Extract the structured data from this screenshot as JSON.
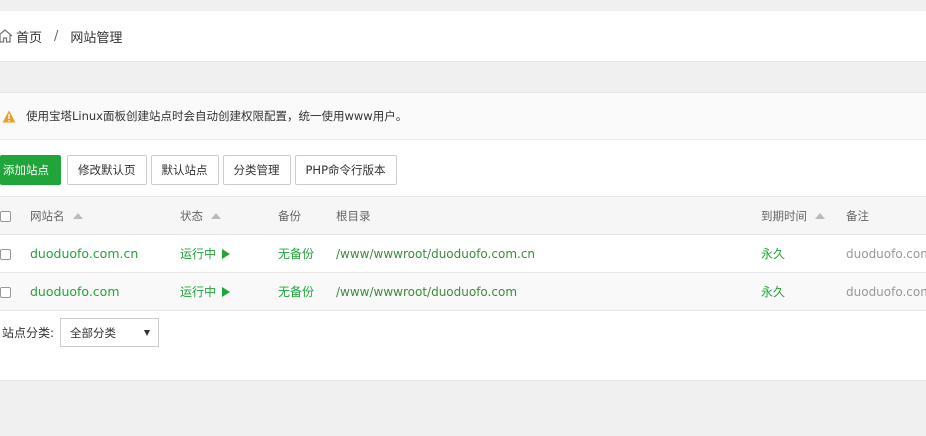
{
  "breadcrumb": {
    "home": "首页",
    "separator": "/",
    "current": "网站管理"
  },
  "notice": {
    "text": "使用宝塔Linux面板创建站点时会自动创建权限配置，统一使用www用户。"
  },
  "toolbar": {
    "add_site": "添加站点",
    "edit_default_page": "修改默认页",
    "default_site": "默认站点",
    "category_manage": "分类管理",
    "php_cli_version": "PHP命令行版本"
  },
  "table": {
    "headers": {
      "site_name": "网站名",
      "status": "状态",
      "backup": "备份",
      "root_dir": "根目录",
      "expire": "到期时间",
      "note": "备注"
    },
    "rows": [
      {
        "site_name": "duoduofo.com.cn",
        "status": "运行中",
        "backup": "无备份",
        "root_dir": "/www/wwwroot/duoduofo.com.cn",
        "expire": "永久",
        "note": "duoduofo.com.cn"
      },
      {
        "site_name": "duoduofo.com",
        "status": "运行中",
        "backup": "无备份",
        "root_dir": "/www/wwwroot/duoduofo.com",
        "expire": "永久",
        "note": "duoduofo.com"
      }
    ]
  },
  "category_filter": {
    "label": "站点分类:",
    "selected": "全部分类"
  },
  "colors": {
    "accent": "#20a53a",
    "warning": "#f0a020"
  }
}
